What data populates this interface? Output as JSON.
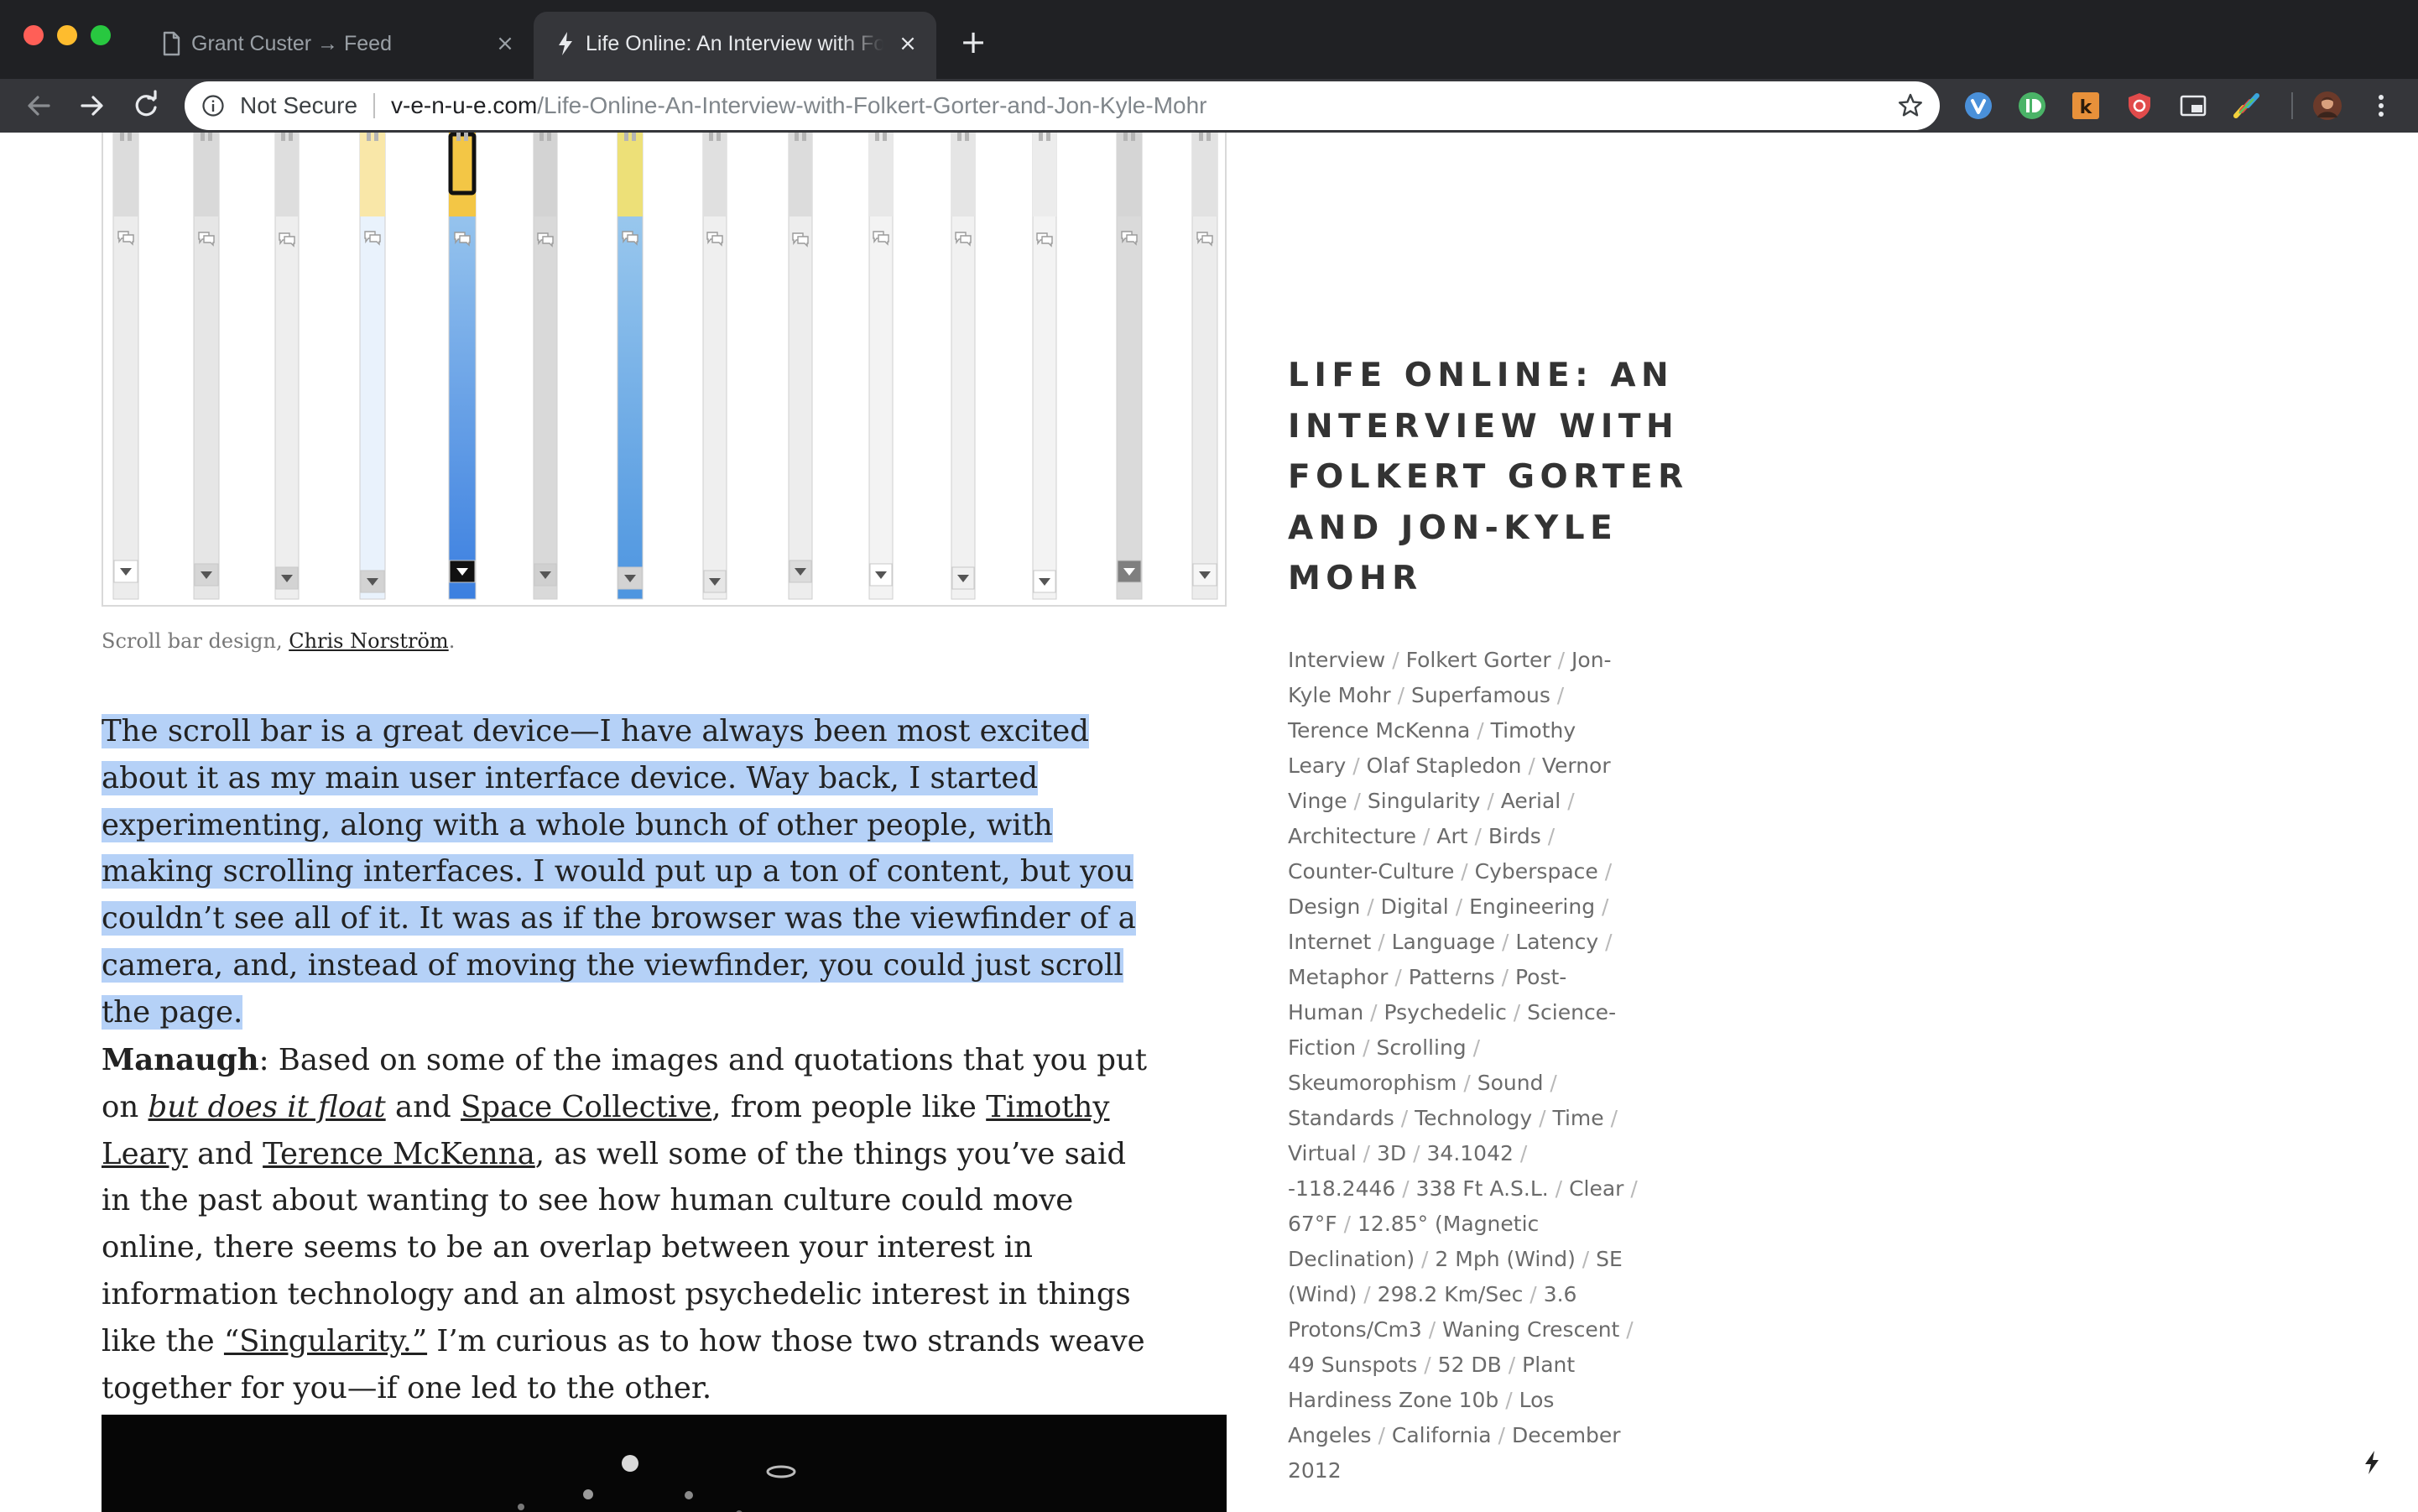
{
  "tabs": [
    {
      "title": "Grant Custer → Feed",
      "close": "×",
      "active": false
    },
    {
      "title": "Life Online: An Interview with Folkert Gorter and Jon-Kyle Mohr",
      "close": "×",
      "active": true
    }
  ],
  "new_tab": "+",
  "toolbar": {
    "security_label": "Not Secure",
    "url_host": "v-e-n-u-e.com",
    "url_path": "/Life-Online-An-Interview-with-Folkert-Gorter-and-Jon-Kyle-Mohr"
  },
  "extensions": [
    "vivaldi-icon",
    "pushbullet-icon",
    "k-icon",
    "shield-icon",
    "picture-in-picture-icon",
    "colorpicker-icon"
  ],
  "article": {
    "caption_prefix": "Scroll bar design, ",
    "caption_link": "Chris Norström",
    "caption_suffix": ".",
    "paragraph_1": "The scroll bar is a great device—I have always been most excited about it as my main user interface device. Way back, I started experimenting, along with a whole bunch of other people, with making scrolling interfaces. I would put up a ton of content, but you couldn’t see all of it. It was as if the browser was the viewfinder of a camera, and, instead of moving the viewfinder, you could just scroll the page.",
    "p2_speaker": "Manaugh",
    "p2_t1": ": Based on some of the images and quotations that you put on ",
    "p2_link1": "but does it float",
    "p2_t2": " and ",
    "p2_link2": "Space Collective",
    "p2_t3": ", from people like ",
    "p2_link3": "Timothy Leary",
    "p2_t4": " and ",
    "p2_link4": "Terence McKenna",
    "p2_t5": ", as well some of the things you’ve said in the past about wanting to see how human culture could move online, there seems to be an overlap between your interest in information technology and an almost psychedelic interest in things like the ",
    "p2_link5": "“Singularity.”",
    "p2_t6": " I’m curious as to how those two strands weave together for you—if one led to the other."
  },
  "sidebar": {
    "title": "Life Online: An Interview with Folkert Gorter and Jon-Kyle Mohr",
    "tags": [
      "Interview",
      "Folkert Gorter",
      "Jon-Kyle Mohr",
      "Superfamous",
      "Terence McKenna",
      "Timothy Leary",
      "Olaf Stapledon",
      "Vernor Vinge",
      "Singularity",
      "Aerial",
      "Architecture",
      "Art",
      "Birds",
      "Counter-Culture",
      "Cyberspace",
      "Design",
      "Digital",
      "Engineering",
      "Internet",
      "Language",
      "Latency",
      "Metaphor",
      "Patterns",
      "Post-Human",
      "Psychedelic",
      "Science-Fiction",
      "Scrolling",
      "Skeumorophism",
      "Sound",
      "Standards",
      "Technology",
      "Time",
      "Virtual",
      "3D",
      "34.1042",
      "-118.2446",
      "338 Ft A.S.L.",
      "Clear",
      "67°F",
      "12.85° (Magnetic Declination)",
      "2 Mph (Wind)",
      "SE (Wind)",
      "298.2 Km/Sec",
      "3.6 Protons/Cm3",
      "Waning Crescent",
      "49 Sunspots",
      "52 DB",
      "Plant Hardiness Zone 10b",
      "Los Angeles",
      "California",
      "December 2012"
    ],
    "separator": "/"
  },
  "scrollbars": [
    {
      "thumb": "#dcdcdc",
      "track": "#ececec",
      "arrow": "#ffffff"
    },
    {
      "thumb": "#d9d9d9",
      "track": "#e6e6e6",
      "arrow": "#d6d6d6"
    },
    {
      "thumb": "#dedede",
      "track": "#eeeeee",
      "arrow": "#d3d3d3"
    },
    {
      "thumb": "#f9e7a8",
      "track": "#e9f2fc",
      "arrow": "#d3d3d3"
    },
    {
      "thumb": "#f3c645",
      "track": "#3b7fe0",
      "arrow": "#111111"
    },
    {
      "thumb": "#d3d3d3",
      "track": "#d9d9d9",
      "arrow": "#d0d0d0"
    },
    {
      "thumb": "#ede078",
      "track": "#4d95e0",
      "arrow": "#d3d3d3"
    },
    {
      "thumb": "#e0e0e0",
      "track": "#efefef",
      "arrow": "#e6e6e6"
    },
    {
      "thumb": "#dcdcdc",
      "track": "#ededed",
      "arrow": "#dcdcdc"
    },
    {
      "thumb": "#e8e8e8",
      "track": "#f3f3f3",
      "arrow": "#ffffff"
    },
    {
      "thumb": "#e5e5e5",
      "track": "#f1f1f1",
      "arrow": "#f0f0f0"
    },
    {
      "thumb": "#ececec",
      "track": "#f3f3f3",
      "arrow": "#ffffff"
    },
    {
      "thumb": "#d5d5d5",
      "track": "#dadada",
      "arrow": "#7f7f7f"
    },
    {
      "thumb": "#e2e2e2",
      "track": "#ececec",
      "arrow": "#f6f6f6"
    }
  ]
}
